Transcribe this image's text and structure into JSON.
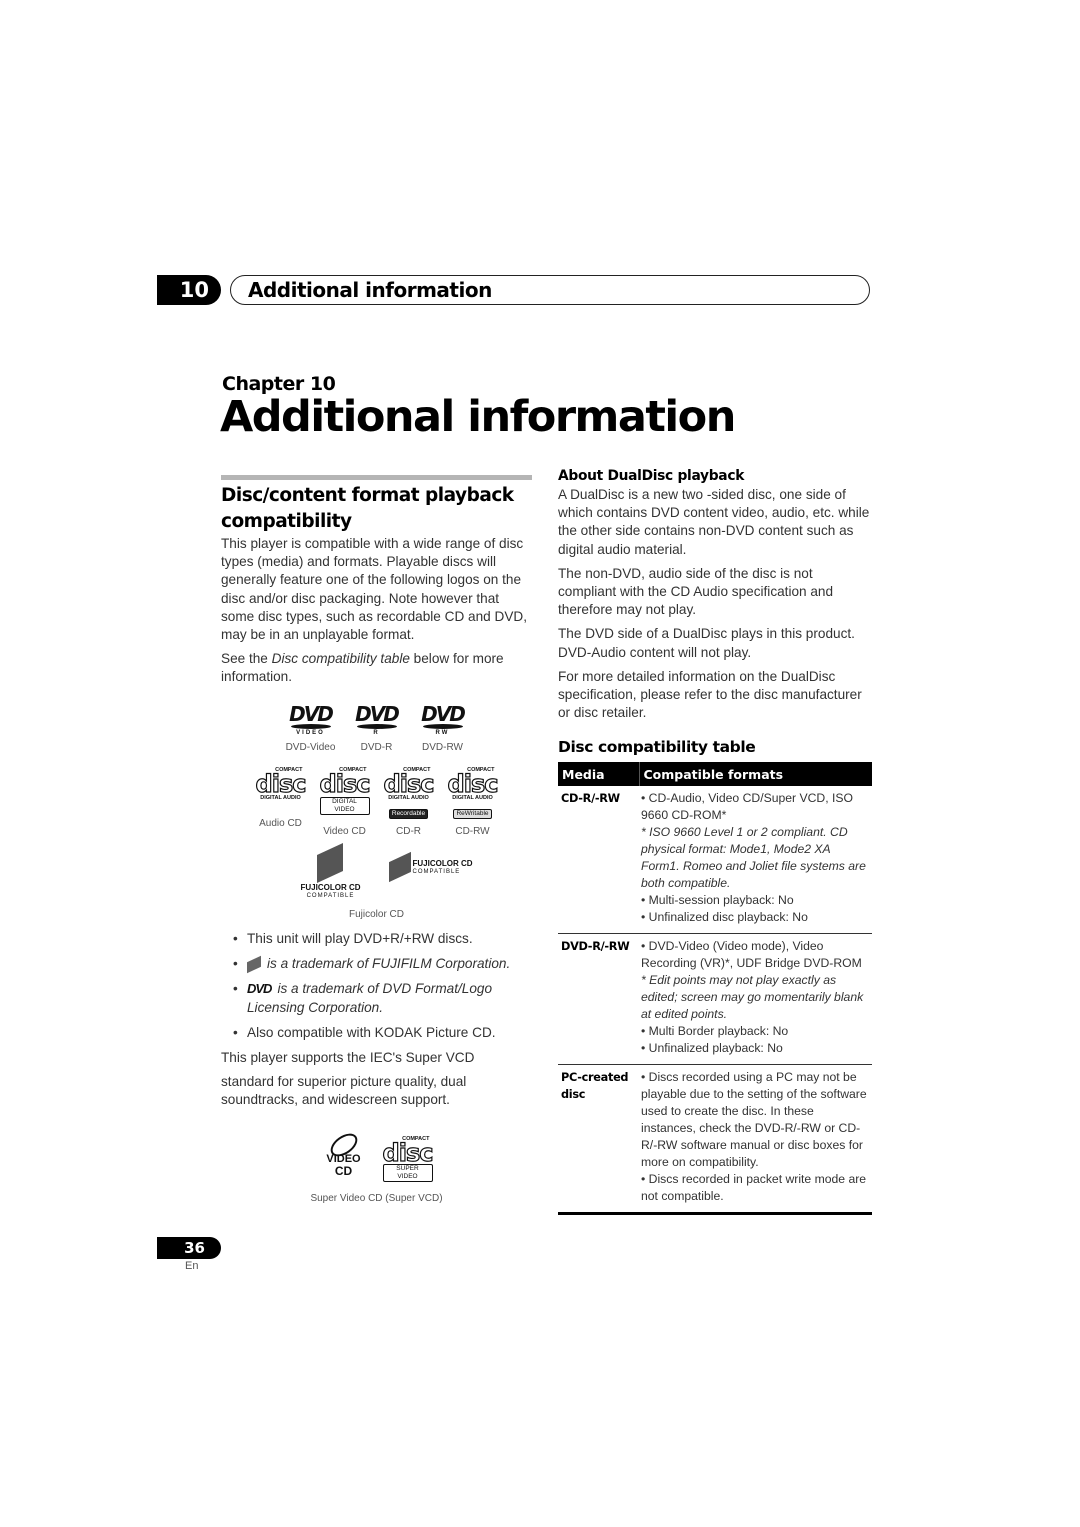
{
  "header": {
    "chapter_number": "10",
    "chapter_title": "Additional information"
  },
  "chapter": {
    "label": "Chapter 10",
    "title": "Additional information"
  },
  "left": {
    "heading": "Disc/content format playback compatibility",
    "intro": "This player is compatible with a wide range of disc types (media) and formats. Playable discs will generally feature one of the following logos on the disc and/or disc packaging. Note however that some disc types, such as recordable CD and DVD, may be in an unplayable format.",
    "see_prefix": "See the ",
    "see_link": "Disc compatibility table",
    "see_suffix": " below for more information.",
    "dvd_logos": [
      {
        "mark": "DVD",
        "sub": "VIDEO",
        "caption": "DVD-Video"
      },
      {
        "mark": "DVD",
        "sub": "R",
        "caption": "DVD-R"
      },
      {
        "mark": "DVD",
        "sub": "RW",
        "caption": "DVD-RW"
      }
    ],
    "cd_logos": [
      {
        "compact": "COMPACT",
        "disc": "disc",
        "sub": "DIGITAL AUDIO",
        "box": "",
        "caption": "Audio CD"
      },
      {
        "compact": "COMPACT",
        "disc": "disc",
        "sub": "",
        "box": "DIGITAL VIDEO",
        "caption": "Video CD"
      },
      {
        "compact": "COMPACT",
        "disc": "disc",
        "sub": "DIGITAL AUDIO",
        "box": "Recordable",
        "caption": "CD-R"
      },
      {
        "compact": "COMPACT",
        "disc": "disc",
        "sub": "DIGITAL AUDIO",
        "box": "ReWritable",
        "caption": "CD-RW"
      }
    ],
    "fuji": {
      "logo_text": "FUJICOLOR CD",
      "logo_sub": "COMPATIBLE",
      "caption": "Fujicolor CD"
    },
    "bullets": [
      "This unit will play DVD+R/+RW discs.",
      "is a trademark of FUJIFILM Corporation.",
      "is a trademark of DVD Format/Logo Licensing Corporation.",
      "Also compatible with KODAK Picture CD."
    ],
    "svcd_para_1": "This player supports the IEC's Super VCD",
    "svcd_para_2": "standard for superior picture quality, dual soundtracks, and widescreen support.",
    "svcd_logo": {
      "vcd_top": "VIDEO",
      "vcd_bottom": "CD",
      "compact": "COMPACT",
      "disc": "disc",
      "box": "SUPER VIDEO",
      "caption": "Super Video CD (Super VCD)"
    }
  },
  "right": {
    "dualdisc_heading": "About DualDisc playback",
    "dualdisc_paras": [
      "A DualDisc is a new two -sided disc, one side of which contains DVD content video, audio, etc. while the other side contains non-DVD content such as digital audio material.",
      "The non-DVD, audio side of the disc is not compliant with the CD Audio specification and therefore may not play.",
      "The DVD side of a DualDisc plays in this product. DVD-Audio content will not play.",
      "For more detailed information on the DualDisc specification, please refer to the disc manufacturer or disc retailer."
    ],
    "table_heading": "Disc compatibility table",
    "table": {
      "columns": [
        "Media",
        "Compatible formats"
      ],
      "rows": [
        {
          "media": "CD-R/-RW",
          "lines": [
            {
              "text": "• CD-Audio, Video CD/Super VCD, ISO 9660 CD-ROM*",
              "italic": false
            },
            {
              "text": "* ISO 9660 Level 1 or 2 compliant. CD physical format: Mode1, Mode2 XA Form1. Romeo and Joliet file systems are both compatible.",
              "italic": true
            },
            {
              "text": "• Multi-session playback: No",
              "italic": false
            },
            {
              "text": "• Unfinalized disc playback: No",
              "italic": false
            }
          ]
        },
        {
          "media": "DVD-R/-RW",
          "lines": [
            {
              "text": "• DVD-Video (Video mode), Video Recording (VR)*, UDF Bridge DVD-ROM",
              "italic": false
            },
            {
              "text": "* Edit points may not play exactly as edited; screen may go momentarily blank at edited points.",
              "italic": true
            },
            {
              "text": "• Multi Border playback: No",
              "italic": false
            },
            {
              "text": "• Unfinalized playback: No",
              "italic": false
            }
          ]
        },
        {
          "media": "PC-created disc",
          "lines": [
            {
              "text": "• Discs recorded using a PC may not be playable due to the setting of the software used to create the disc. In these instances, check the DVD-R/-RW or CD-R/-RW software manual or disc boxes for more on compatibility.",
              "italic": false
            },
            {
              "text": "• Discs recorded in packet write mode are not compatible.",
              "italic": false
            }
          ]
        }
      ]
    }
  },
  "footer": {
    "page_number": "36",
    "language": "En"
  }
}
